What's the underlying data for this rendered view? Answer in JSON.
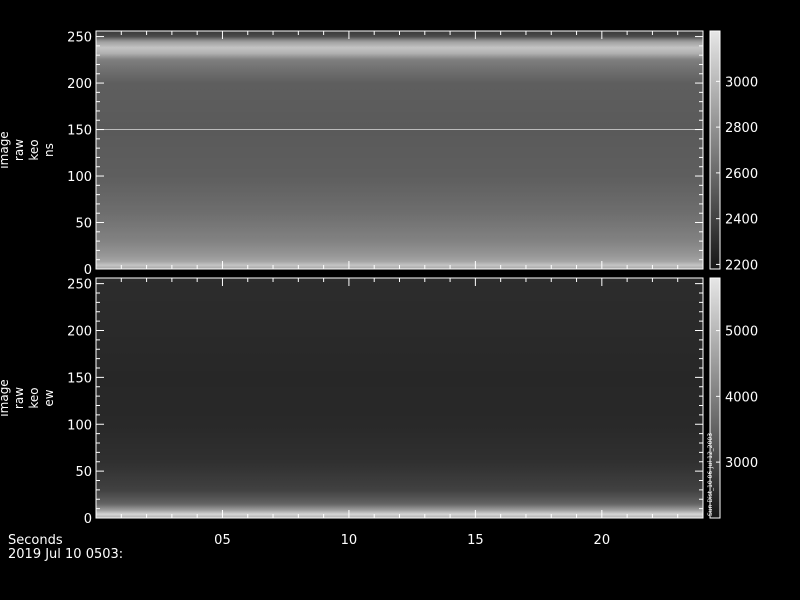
{
  "chart_data": [
    {
      "type": "heatmap",
      "ylabel_lines": [
        "image",
        "raw",
        "keo",
        "ns"
      ],
      "ylim": [
        0,
        256
      ],
      "yticks": [
        0,
        50,
        100,
        150,
        200,
        250
      ],
      "colorbar": {
        "range": [
          2180,
          3220
        ],
        "ticks": [
          2200,
          2400,
          2600,
          2800,
          3000
        ]
      },
      "xlim": [
        0,
        24
      ],
      "xticks": [
        5,
        10,
        15,
        20
      ],
      "profile": {
        "rows": [
          0,
          4,
          8,
          15,
          30,
          60,
          100,
          150,
          200,
          225,
          232,
          238,
          245,
          250,
          256
        ],
        "values": [
          2900,
          3050,
          2900,
          2820,
          2720,
          2620,
          2540,
          2520,
          2540,
          2700,
          2950,
          3050,
          2850,
          2450,
          2350
        ]
      },
      "bright_line_row": 150
    },
    {
      "type": "heatmap",
      "ylabel_lines": [
        "image",
        "raw",
        "keo",
        "ew"
      ],
      "ylim": [
        0,
        256
      ],
      "yticks": [
        0,
        50,
        100,
        150,
        200,
        250
      ],
      "colorbar": {
        "range": [
          2150,
          5800
        ],
        "ticks": [
          3000,
          4000,
          5000
        ],
        "side_label": "Sun Dist_10 06-Jul-12_2003"
      },
      "xlim": [
        0,
        24
      ],
      "xticks": [
        5,
        10,
        15,
        20
      ],
      "profile": {
        "rows": [
          0,
          4,
          8,
          15,
          30,
          60,
          100,
          150,
          200,
          256
        ],
        "values": [
          4800,
          5500,
          4600,
          3500,
          2900,
          2600,
          2480,
          2450,
          2500,
          2550
        ]
      }
    }
  ],
  "xaxis": {
    "tick_labels": [
      "05",
      "10",
      "15",
      "20"
    ],
    "label": "Seconds",
    "date": "2019 Jul 10 0503:"
  },
  "colors": {
    "background": "#000000",
    "axis": "#ffffff"
  }
}
